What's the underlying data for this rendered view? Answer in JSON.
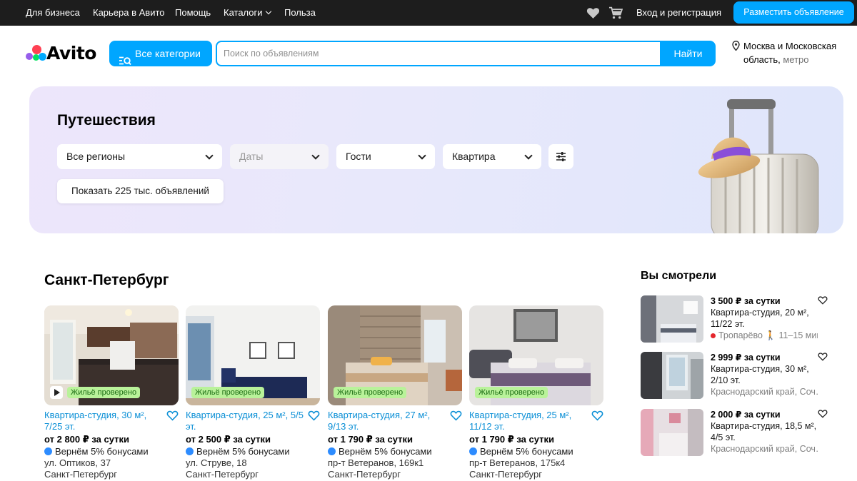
{
  "topbar": {
    "links": [
      "Для бизнеса",
      "Карьера в Авито",
      "Помощь",
      "Каталоги",
      "Польза"
    ],
    "login": "Вход и регистрация",
    "post_button": "Разместить объявление"
  },
  "header": {
    "logo_text": "Avito",
    "all_categories": "Все категории",
    "search_placeholder": "Поиск по объявлениям",
    "search_button": "Найти",
    "location_line1": "Москва и Московская",
    "location_line2": "область,",
    "location_metro": " метро"
  },
  "banner": {
    "title": "Путешествия",
    "filters": [
      "Все регионы",
      "Даты",
      "Гости",
      "Квартира"
    ],
    "show_button": "Показать 225 тыс. объявлений"
  },
  "main": {
    "city": "Санкт-Петербург",
    "cards": [
      {
        "badge": "Жильё проверено",
        "title": "Квартира-студия, 30 м², 7/25 эт.",
        "price": "от 2 800 ₽ за сутки",
        "bonus": "Вернём 5% бонусами",
        "address1": "ул. Оптиков, 37",
        "address2": "Санкт-Петербург"
      },
      {
        "badge": "Жильё проверено",
        "title": "Квартира-студия, 25 м², 5/5 эт.",
        "price": "от 2 500 ₽ за сутки",
        "bonus": "Вернём 5% бонусами",
        "address1": "ул. Струве, 18",
        "address2": "Санкт-Петербург"
      },
      {
        "badge": "Жильё проверено",
        "title": "Квартира-студия, 27 м², 9/13 эт.",
        "price": "от 1 790 ₽ за сутки",
        "bonus": "Вернём 5% бонусами",
        "address1": "пр-т Ветеранов, 169к1",
        "address2": "Санкт-Петербург"
      },
      {
        "badge": "Жильё проверено",
        "title": "Квартира-студия, 25 м², 11/12 эт.",
        "price": "от 1 790 ₽ за сутки",
        "bonus": "Вернём 5% бонусами",
        "address1": "пр-т Ветеранов, 175к4",
        "address2": "Санкт-Петербург"
      }
    ]
  },
  "seen": {
    "title": "Вы смотрели",
    "items": [
      {
        "price": "3 500 ₽ за сутки",
        "desc1": "Квартира-студия, 20 м²,",
        "desc2": "11/22 эт.",
        "loc": "Тропарёво",
        "walk": " 11–15 мин."
      },
      {
        "price": "2 999 ₽ за сутки",
        "desc1": "Квартира-студия, 30 м²,",
        "desc2": "2/10 эт.",
        "loc": "Краснодарский край, Соч…"
      },
      {
        "price": "2 000 ₽ за сутки",
        "desc1": "Квартира-студия, 18,5 м²,",
        "desc2": "4/5 эт.",
        "loc": "Краснодарский край, Соч…"
      }
    ]
  },
  "colors": {
    "accent": "#00a6ff",
    "badge_bg": "#b9f29a",
    "link": "#0a8fd6",
    "topbar": "#1d1d1d"
  }
}
